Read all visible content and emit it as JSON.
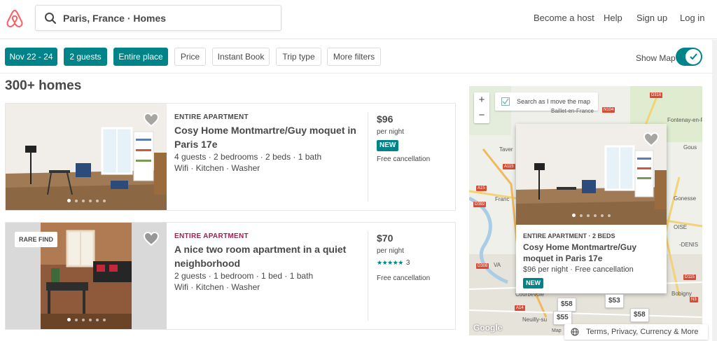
{
  "header": {
    "search_value": "Paris, France · Homes",
    "nav": [
      "Become a host",
      "Help",
      "Sign up",
      "Log in"
    ]
  },
  "filters": {
    "chips": [
      "Nov 22 - 24",
      "2 guests",
      "Entire place",
      "Price",
      "Instant Book",
      "Trip type",
      "More filters"
    ],
    "show_map_label": "Show Map",
    "show_map_on": true
  },
  "results": {
    "count_label": "300+ homes",
    "listings": [
      {
        "type": "ENTIRE APARTMENT",
        "title": "Cosy Home Montmartre/Guy moquet in Paris 17e",
        "specs": "4 guests · 2 bedrooms · 2 beds · 1 bath",
        "amenities": "Wifi · Kitchen · Washer",
        "price": "$96",
        "per_night": "per night",
        "badge": "NEW",
        "cancellation": "Free cancellation"
      },
      {
        "type": "ENTIRE APARTMENT",
        "rare_label": "RARE FIND",
        "title": "A nice two room apartment in a quiet neighborhood",
        "specs": "2 guests · 1 bedroom · 1 bed · 1 bath",
        "amenities": "Wifi · Kitchen · Washer",
        "price": "$70",
        "per_night": "per night",
        "stars": "★★★★★",
        "rating": 4.5,
        "review_count": "3",
        "cancellation": "Free cancellation"
      }
    ]
  },
  "map": {
    "zoom_in": "+",
    "zoom_out": "−",
    "search_as_move_label": "Search as I move the map",
    "labels": {
      "baillet": "Baillet-en-France",
      "fontenay": "Fontenay-en-F",
      "gous": "Gous",
      "taver": "Taver",
      "franc": "Franc",
      "gonesse": "Gonesse",
      "bobigny": "Bobigny",
      "courbevoie": "Courbevoie",
      "neuilly": "Neuilly-su",
      "denis": "-DENIS",
      "oise": "OISE",
      "d316": "D316",
      "n104": "N104",
      "a115": "A115",
      "a15": "A15",
      "d392": "D392",
      "d308": "D308",
      "d115": "D115",
      "a14": "A14",
      "n3": "N3",
      "va": "VA"
    },
    "popup": {
      "type": "ENTIRE APARTMENT · 2 BEDS",
      "title": "Cosy Home Montmartre/Guy moquet in Paris 17e",
      "meta": "$96 per night · Free cancellation",
      "badge": "NEW"
    },
    "pins": [
      "$58",
      "$53",
      "$55",
      "$58"
    ],
    "google": "Google",
    "map_label": "Map",
    "terms": "Terms, Privacy, Currency & More"
  },
  "colors": {
    "accent": "#008489",
    "brand": "#ff5a5f",
    "rare": "#a61d55"
  }
}
